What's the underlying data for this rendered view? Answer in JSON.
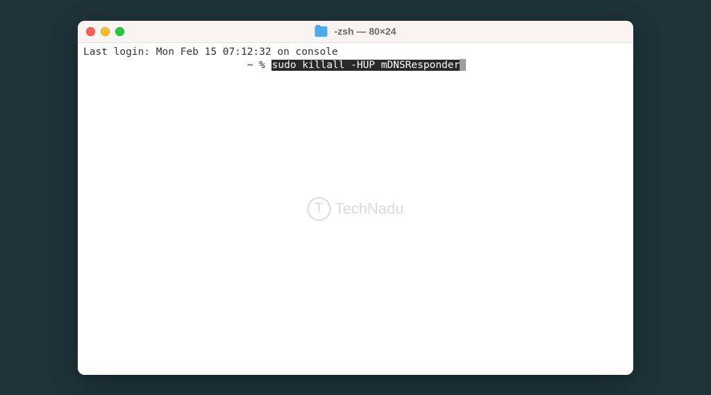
{
  "window": {
    "title": "-zsh — 80×24"
  },
  "terminal": {
    "login_line": "Last login: Mon Feb 15 07:12:32 on console",
    "prompt_indent": "                           ",
    "prompt_prefix": "~ % ",
    "command": "sudo killall -HUP mDNSResponder"
  },
  "watermark": {
    "letter": "T",
    "text": "TechNadu"
  }
}
